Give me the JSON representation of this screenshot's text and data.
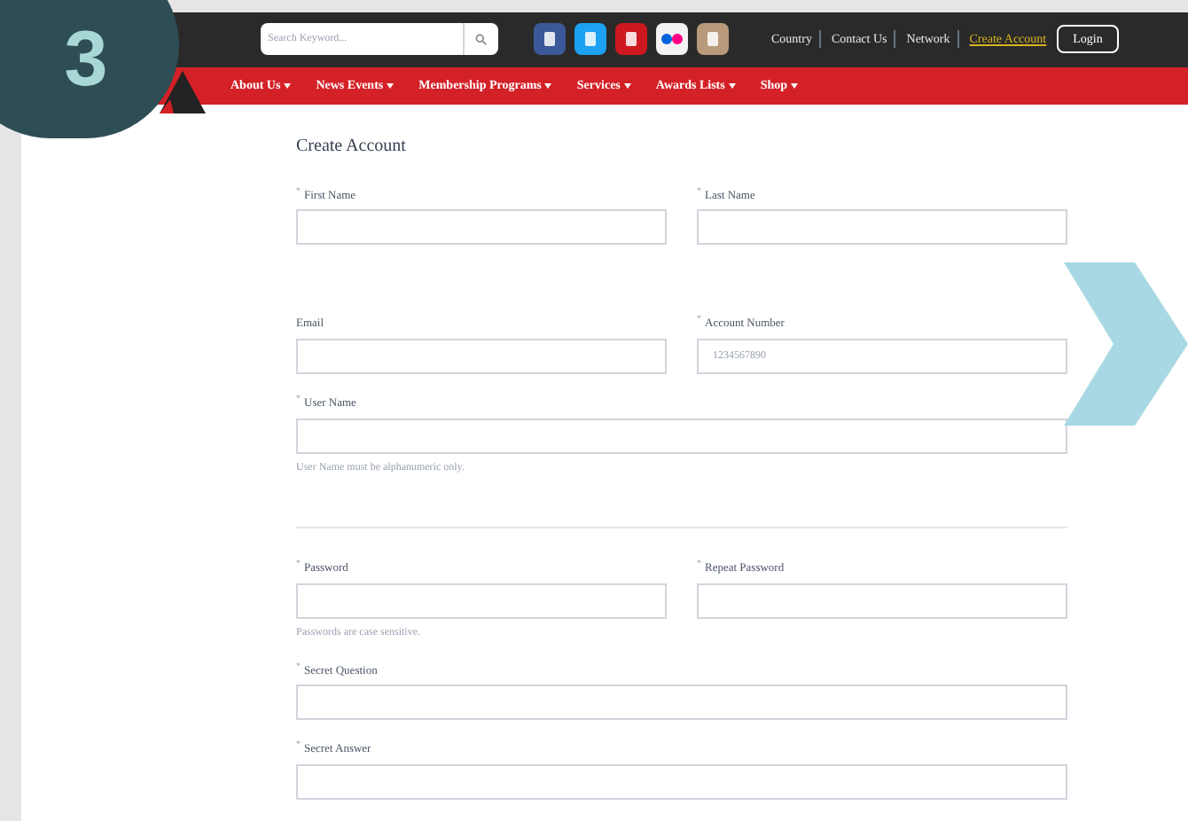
{
  "step_badge": "3",
  "header": {
    "search": {
      "placeholder": "Search Keyword..."
    },
    "social": [
      {
        "kind": "facebook"
      },
      {
        "kind": "twitter"
      },
      {
        "kind": "youtube"
      },
      {
        "kind": "flickr"
      },
      {
        "kind": "instagram"
      }
    ],
    "links": [
      {
        "label": "Country",
        "kind": "plain"
      },
      {
        "label": "Contact Us",
        "kind": "plain"
      },
      {
        "label": "Network",
        "kind": "plain"
      },
      {
        "label": "Create Account",
        "kind": "highlight"
      },
      {
        "label": "Login",
        "kind": "button"
      }
    ]
  },
  "nav": [
    {
      "label": "About Us"
    },
    {
      "label": "News Events"
    },
    {
      "label": "Membership Programs"
    },
    {
      "label": "Services"
    },
    {
      "label": "Awards Lists"
    },
    {
      "label": "Shop"
    }
  ],
  "form": {
    "title": "Create Account",
    "rows": [
      {
        "fields": [
          {
            "label": "First Name",
            "mark": "*"
          },
          {
            "label": "Last Name",
            "mark": "*"
          }
        ]
      },
      {
        "fields": [
          {
            "label": "Email"
          },
          {
            "label": "Account Number",
            "mark": "*",
            "placeholder": "1234567890"
          }
        ],
        "gap": true
      },
      {
        "fields": [
          {
            "label": "User Name",
            "mark": "*"
          }
        ],
        "hint": "User Name must be alphanumeric only."
      },
      {
        "fields": [
          {
            "label": "Password",
            "mark": "*"
          },
          {
            "label": "Repeat Password",
            "mark": "*"
          }
        ],
        "hint": "Passwords are case sensitive.",
        "divider": true
      },
      {
        "fields": [
          {
            "label": "Secret Question",
            "mark": "*"
          }
        ]
      },
      {
        "fields": [
          {
            "label": "Secret Answer",
            "mark": "*"
          }
        ]
      }
    ]
  }
}
